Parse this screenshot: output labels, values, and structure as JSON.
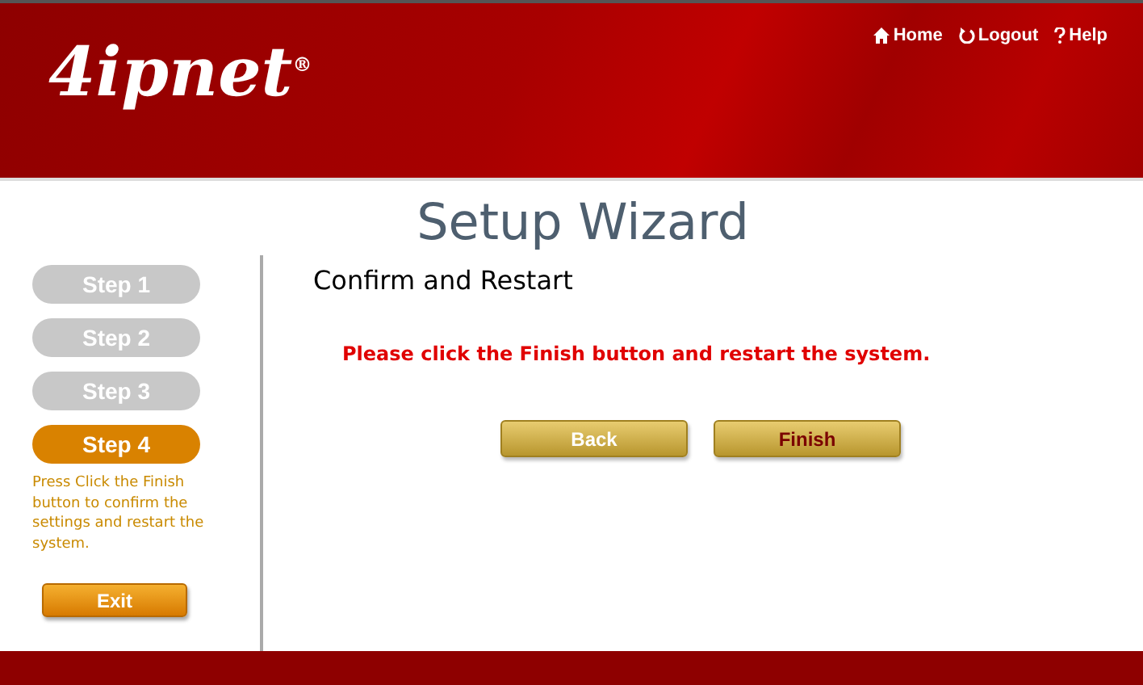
{
  "header": {
    "logo": "4ipnet$^{®}$",
    "links": [
      {
        "kind": "home",
        "label": "Home"
      },
      {
        "kind": "logout",
        "label": "Logout"
      },
      {
        "kind": "help",
        "label": "Help"
      }
    ]
  },
  "title": "Setup Wizard",
  "steps": [
    {
      "label": "Step 1",
      "selected": false
    },
    {
      "label": "Step 2",
      "selected": false
    },
    {
      "label": "Step 3",
      "selected": false
    },
    {
      "label": "Step 4",
      "selected": true
    }
  ],
  "step_hint": "Press Click the Finish button to confirm the settings and restart the system.",
  "exit_button": "Exit",
  "section_title": "Confirm and Restart",
  "message": "Please click the Finish button and restart the system.",
  "buttons": [
    {
      "label": "Back",
      "kind": "secondary"
    },
    {
      "label": "Finish",
      "kind": "primary"
    }
  ]
}
